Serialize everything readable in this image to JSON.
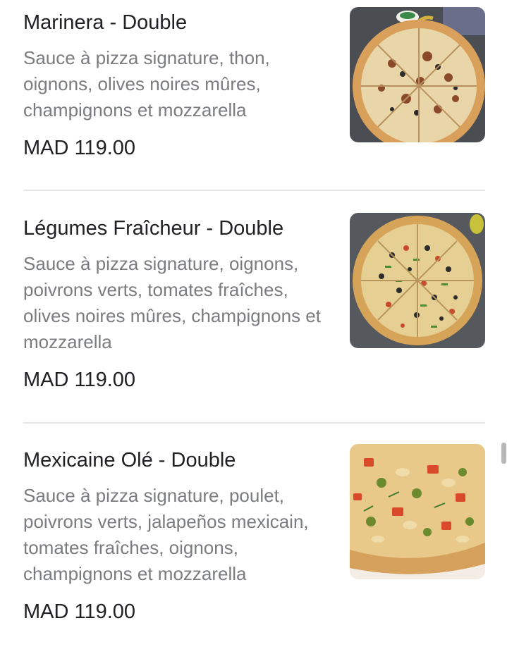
{
  "items": [
    {
      "title": "Marinera - Double",
      "description": "Sauce à pizza signature, thon, oignons, olives noires mûres, champignons et mozzarella",
      "price": "MAD 119.00",
      "image_icon": "pizza-marinera-image"
    },
    {
      "title": "Légumes Fraîcheur - Double",
      "description": "Sauce à pizza signature, oignons, poivrons verts, tomates fraîches, olives noires mûres, champignons et mozzarella",
      "price": "MAD 119.00",
      "image_icon": "pizza-legumes-image"
    },
    {
      "title": "Mexicaine Olé - Double",
      "description": "Sauce à pizza signature, poulet, poivrons verts, jalapeños mexicain, tomates fraîches, oignons, champignons et mozzarella",
      "price": "MAD 119.00",
      "image_icon": "pizza-mexicaine-image"
    }
  ],
  "colors": {
    "title": "#202124",
    "description": "#7a7c80",
    "divider": "#e6e6e6",
    "scrollbar": "#b7b7b7"
  }
}
